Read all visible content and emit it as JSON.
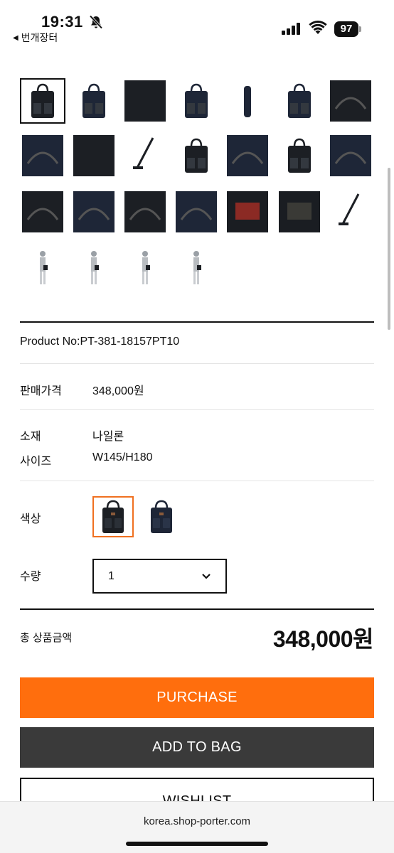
{
  "status_bar": {
    "time": "19:31",
    "back_app_label": "번개장터",
    "battery": "97"
  },
  "thumbnails": [
    {
      "name": "bag-front",
      "selected": true
    },
    {
      "name": "bag-front-alt"
    },
    {
      "name": "fabric-closeup"
    },
    {
      "name": "bag-back"
    },
    {
      "name": "bag-side"
    },
    {
      "name": "bag-rear-plain"
    },
    {
      "name": "bag-bottom"
    },
    {
      "name": "bag-open-top"
    },
    {
      "name": "fabric-navy"
    },
    {
      "name": "strap"
    },
    {
      "name": "bag-with-strap"
    },
    {
      "name": "strap-clip"
    },
    {
      "name": "bag-handle-detail"
    },
    {
      "name": "zipper-detail"
    },
    {
      "name": "pocket-detail"
    },
    {
      "name": "interior-pocket"
    },
    {
      "name": "interior-open"
    },
    {
      "name": "interior-mesh"
    },
    {
      "name": "label-red"
    },
    {
      "name": "label-porter"
    },
    {
      "name": "strap-full"
    },
    {
      "name": "model-side"
    },
    {
      "name": "model-front"
    },
    {
      "name": "model-angle"
    },
    {
      "name": "model-back"
    }
  ],
  "product": {
    "product_no": "Product No:PT-381-18157PT10",
    "price_label": "판매가격",
    "price_value": "348,000원",
    "material_label": "소재",
    "material_value": "나일론",
    "size_label": "사이즈",
    "size_value": "W145/H180",
    "color_label": "색상",
    "quantity_label": "수량",
    "quantity_value": "1",
    "total_label": "총 상품금액",
    "total_value": "348,000원"
  },
  "buttons": {
    "purchase": "PURCHASE",
    "add_to_bag": "ADD TO BAG",
    "wishlist": "WISHLIST"
  },
  "browser": {
    "url": "korea.shop-porter.com"
  },
  "colors": {
    "accent_orange": "#ff6e0d",
    "dark_button": "#3a3a3a",
    "bag_black": "#1c1f24",
    "bag_navy": "#1e2637"
  }
}
